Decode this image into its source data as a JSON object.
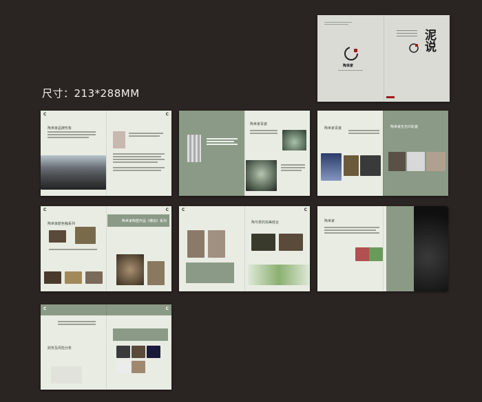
{
  "size_label": "尺寸：213*288MM",
  "cover": {
    "brand_title": "泥说",
    "seal": "陶世家",
    "logo_text": "陶世家"
  },
  "pages": [
    {
      "id": "p1",
      "heading": "陶世家品牌形象"
    },
    {
      "id": "p2",
      "heading": "陶世家青瓷"
    },
    {
      "id": "p3",
      "heading": "陶世家青瓷",
      "heading2": "陶世家无光印彩瓷"
    },
    {
      "id": "p4",
      "heading": "陶世家颜色釉系列",
      "heading2": "陶世家陶塑作品《佛造》系列"
    },
    {
      "id": "p5",
      "heading": "陶与茶的完美结合"
    },
    {
      "id": "p6",
      "heading": "陶世家"
    },
    {
      "id": "p7",
      "heading": "财务及风险分析"
    }
  ],
  "colors": {
    "background": "#2a2422",
    "page": "#e9ece3",
    "band": "#8a9a86"
  }
}
